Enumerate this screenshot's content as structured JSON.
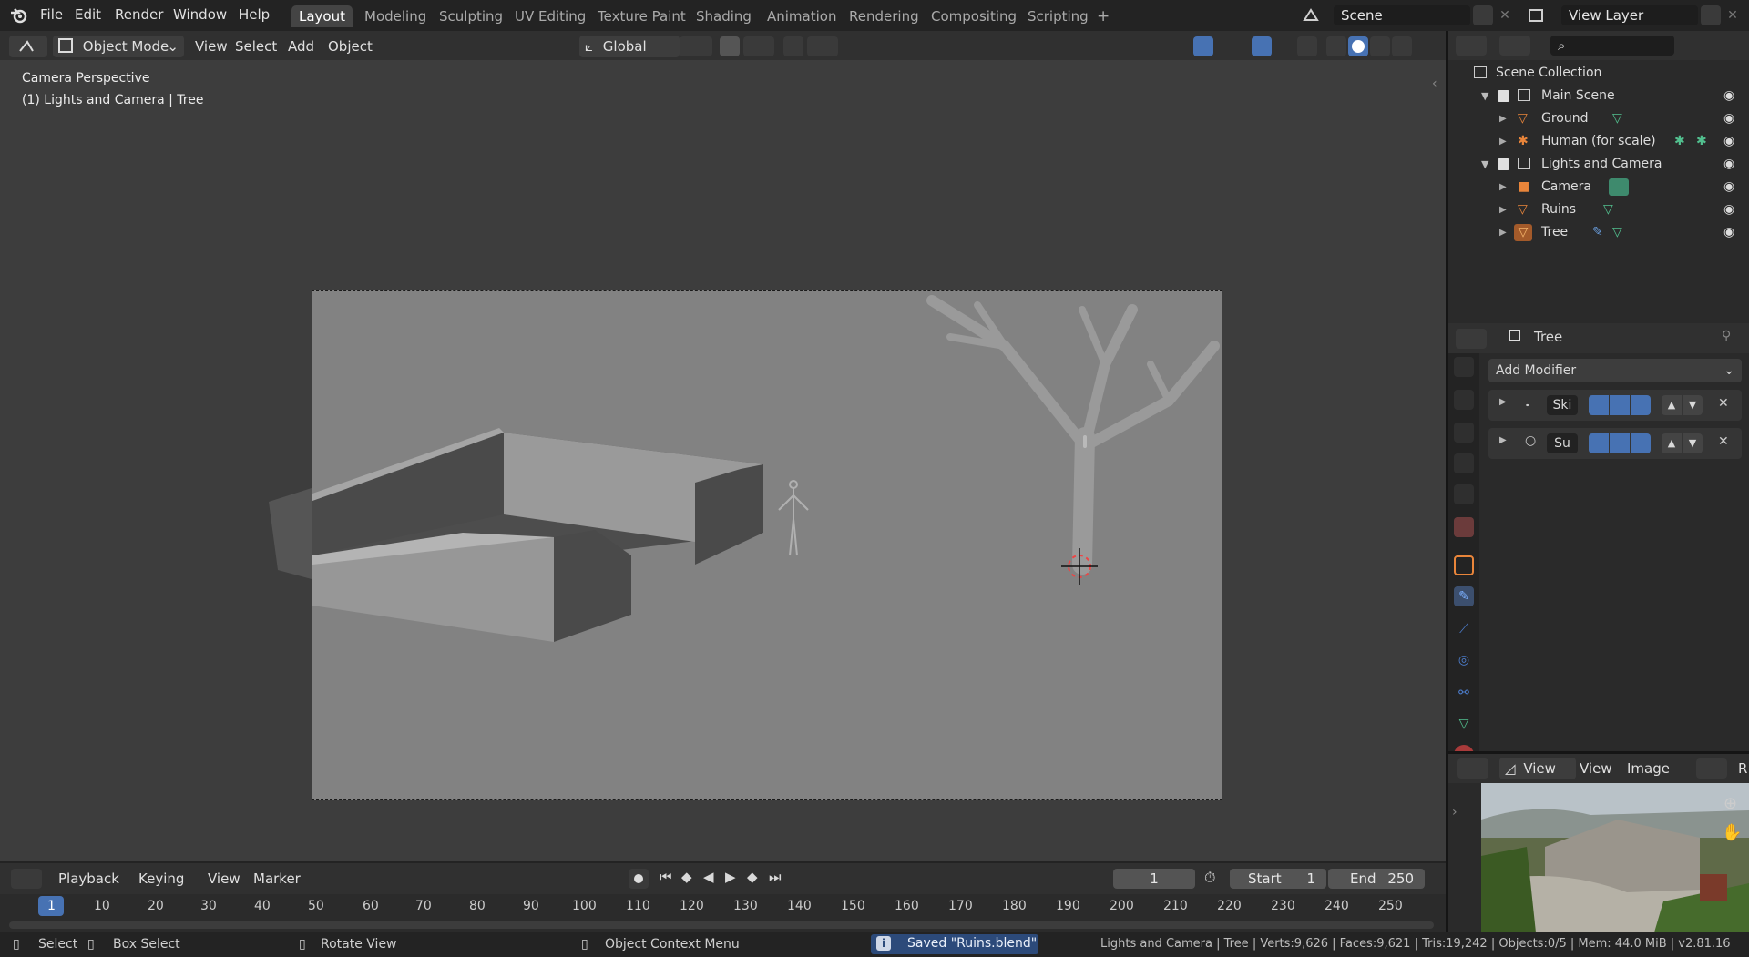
{
  "app": {
    "name": "Blender",
    "version": "v2.81.16"
  },
  "topbar": {
    "menus": [
      "File",
      "Edit",
      "Render",
      "Window",
      "Help"
    ],
    "workspaces": [
      "Layout",
      "Modeling",
      "Sculpting",
      "UV Editing",
      "Texture Paint",
      "Shading",
      "Animation",
      "Rendering",
      "Compositing",
      "Scripting"
    ],
    "active_workspace": "Layout",
    "add_workspace": "+",
    "scene": "Scene",
    "view_layer": "View Layer"
  },
  "viewport_header": {
    "mode": "Object Mode",
    "menus": [
      "View",
      "Select",
      "Add",
      "Object"
    ],
    "transform_orientation": "Global"
  },
  "viewport": {
    "overlay_line1": "Camera Perspective",
    "overlay_line2": "(1) Lights and Camera | Tree"
  },
  "outliner": {
    "root": "Scene Collection",
    "rows": [
      {
        "label": "Main Scene",
        "type": "collection"
      },
      {
        "label": "Ground",
        "type": "mesh"
      },
      {
        "label": "Human (for scale)",
        "type": "armature"
      },
      {
        "label": "Lights and Camera",
        "type": "collection"
      },
      {
        "label": "Camera",
        "type": "camera"
      },
      {
        "label": "Ruins",
        "type": "mesh"
      },
      {
        "label": "Tree",
        "type": "mesh"
      }
    ]
  },
  "properties": {
    "object_name": "Tree",
    "add_modifier": "Add Modifier",
    "modifiers": [
      {
        "name": "Ski"
      },
      {
        "name": "Su"
      }
    ]
  },
  "image_editor": {
    "menus": [
      "View",
      "View",
      "Image"
    ],
    "clipped": "R"
  },
  "timeline": {
    "menus": [
      "Playback",
      "Keying",
      "View",
      "Marker"
    ],
    "current_frame": "1",
    "start_label": "Start",
    "start": "1",
    "end_label": "End",
    "end": "250",
    "ticks": [
      "1",
      "10",
      "20",
      "30",
      "40",
      "50",
      "60",
      "70",
      "80",
      "90",
      "100",
      "110",
      "120",
      "130",
      "140",
      "150",
      "160",
      "170",
      "180",
      "190",
      "200",
      "210",
      "220",
      "230",
      "240",
      "250"
    ]
  },
  "statusbar": {
    "select": "Select",
    "box_select": "Box Select",
    "rotate_view": "Rotate View",
    "context_menu": "Object Context Menu",
    "message": "Saved \"Ruins.blend\"",
    "stats": "Lights and Camera | Tree | Verts:9,626 | Faces:9,621 | Tris:19,242 | Objects:0/5 | Mem: 44.0 MiB | v2.81.16"
  },
  "colors": {
    "accent": "#4772b3",
    "orange": "#e9853a",
    "green": "#52c08f"
  }
}
